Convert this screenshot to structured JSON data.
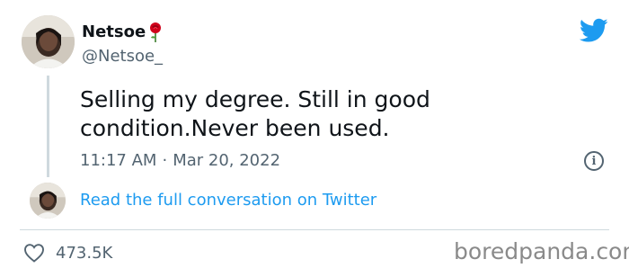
{
  "tweet": {
    "display_name": "Netsoe",
    "display_name_emoji_icon": "rose-icon",
    "handle": "@Netsoe_",
    "text_line1": "Selling my degree. Still in good",
    "text_line2": "condition.Never been used.",
    "time": "11:17 AM",
    "separator": "·",
    "date": "Mar 20, 2022",
    "conversation_link": "Read the full conversation on Twitter",
    "like_count": "473.5K"
  },
  "icons": {
    "logo": "twitter-bird-icon",
    "info": "info-icon",
    "like": "heart-icon"
  },
  "watermark": "boredpanda.com",
  "colors": {
    "accent": "#1d9bf0",
    "text": "#0f1419",
    "secondary": "#536471",
    "divider": "#cfd9de"
  }
}
